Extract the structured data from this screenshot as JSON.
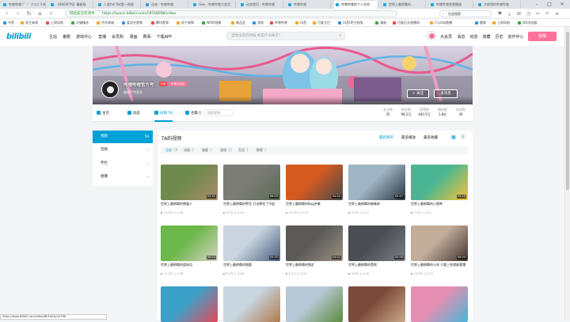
{
  "browser": {
    "tabs": [
      {
        "label": "哔哩哔哩 (゜-゜)つロ 干杯",
        "active": false
      },
      {
        "label": "【4K60FPS】最新版",
        "active": false
      },
      {
        "label": "人类fall flat第一视角",
        "active": false
      },
      {
        "label": "动态 - 哔哩哔哩",
        "active": false
      },
      {
        "label": "Gee - 哔哩哔哩大会员",
        "active": false
      },
      {
        "label": "动态首页 - 哔哩哔哩",
        "active": false
      },
      {
        "label": "哔哩哔哩",
        "active": false
      },
      {
        "label": "哔哩哔哩的个人空间",
        "active": true
      },
      {
        "label": "世界上最倒霉的...",
        "active": false
      },
      {
        "label": "哔哩哔哩视频播放",
        "active": false
      },
      {
        "label": "大侠哥的哔哩哔哩",
        "active": false
      }
    ],
    "secure_label": "网站安全检测中",
    "url": "https://space.bilibili.com/19558098/video",
    "search_value": "在此搜索",
    "bookmarks": [
      "书签",
      "发生来源",
      "上网导航",
      "天猫精选",
      "京东商城",
      "爱奇艺视频",
      "腾讯视频",
      "苏宁易购",
      "NOW直播",
      "唯品会",
      "游戏",
      "哔哩哔哩",
      "抖音",
      "可爱大巴",
      "抖音UP主权限",
      "漫画",
      "可爱石头直播间",
      "Crystal直播",
      "酷狗",
      "上网导航",
      "QQ浏览器"
    ],
    "status_url": "https://www.bilibili.com/video/BV1bG4y1E7B6"
  },
  "site_header": {
    "logo": "bilibili",
    "nav": [
      "主站",
      "番剧",
      "游戏中心",
      "直播",
      "会员购",
      "漫画",
      "赛事",
      "下载APP"
    ],
    "search_placeholder": "当你没有的时候 你是什么样子？",
    "right_nav": [
      "大会员",
      "消息",
      "动态",
      "收藏",
      "历史",
      "创作中心"
    ],
    "upload_label": "投稿"
  },
  "profile": {
    "name": "哔哩哔哩官方号",
    "level": "LV6",
    "vip": "年度大会员",
    "sign": "编辑个性签名",
    "follow_label": "+ 关注",
    "message_label": "发消息",
    "tabs": [
      {
        "label": "主页",
        "active": false
      },
      {
        "label": "动态",
        "active": false
      },
      {
        "label": "投稿 59",
        "active": true
      },
      {
        "label": "合集 1",
        "active": false
      }
    ],
    "search_placeholder": "搜索视频",
    "stats": [
      {
        "label": "关注数",
        "value": "35"
      },
      {
        "label": "粉丝数",
        "value": "98.2万"
      },
      {
        "label": "获赞数",
        "value": "400.5万"
      },
      {
        "label": "播放数",
        "value": "1.8亿"
      },
      {
        "label": "阅读数",
        "value": "39"
      }
    ]
  },
  "left_menu": [
    {
      "label": "视频",
      "count": "59",
      "active": true
    },
    {
      "label": "音频",
      "count": "",
      "active": false
    },
    {
      "label": "专栏",
      "count": "",
      "active": false
    },
    {
      "label": "相簿",
      "count": "",
      "active": false
    }
  ],
  "main": {
    "title": "TA的视频",
    "sorts": [
      {
        "label": "最新发布",
        "active": true
      },
      {
        "label": "最多播放",
        "active": false
      },
      {
        "label": "最多收藏",
        "active": false
      }
    ],
    "filters": [
      {
        "label": "全部",
        "count": "59",
        "active": true
      },
      {
        "label": "动画",
        "count": "3",
        "active": false
      },
      {
        "label": "鬼畜",
        "count": "1",
        "active": false
      },
      {
        "label": "游戏",
        "count": "53",
        "active": false
      },
      {
        "label": "生活",
        "count": "1",
        "active": false
      },
      {
        "label": "影视",
        "count": "1",
        "active": false
      }
    ],
    "videos": [
      {
        "title": "世界上最倒霉的熊猫人",
        "duration": "05:21",
        "plays": "10.2万",
        "date": "4-18",
        "c1": "#6f8a4e",
        "c2": "#a98c6a"
      },
      {
        "title": "世界上最倒霉的警官 打击罪犯了不起",
        "duration": "06:03",
        "plays": "8.7万",
        "date": "4-16",
        "c1": "#7d7d78",
        "c2": "#5a6b53"
      },
      {
        "title": "世界上最倒霉的Bug合集",
        "duration": "04:52",
        "plays": "12.5万",
        "date": "4-14",
        "c1": "#d45a1f",
        "c2": "#4a4a4a"
      },
      {
        "title": "世界上最倒霉的蜘蛛侠",
        "duration": "05:47",
        "plays": "9.3万",
        "date": "4-12",
        "c1": "#9fb5c4",
        "c2": "#2b3540"
      },
      {
        "title": "世界上最倒霉的小黄鸭",
        "duration": "05:10",
        "plays": "7.9万",
        "date": "4-10",
        "c1": "#4ab592",
        "c2": "#f2c23a"
      },
      {
        "title": "世界上最倒霉的篮球员",
        "duration": "06:15",
        "plays": "11.4万",
        "date": "4-08",
        "c1": "#6cb84a",
        "c2": "#d7d2c4"
      },
      {
        "title": "世界上最倒霉的跑酷",
        "duration": "05:33",
        "plays": "6.2万",
        "date": "4-06",
        "c1": "#c9d4de",
        "c2": "#465f7c"
      },
      {
        "title": "世界上最倒霉的铁匠",
        "duration": "04:41",
        "plays": "8.1万",
        "date": "4-04",
        "c1": "#5b5a58",
        "c2": "#9b9181"
      },
      {
        "title": "世界上最倒霉的黑帮",
        "duration": "05:58",
        "plays": "9.6万",
        "date": "4-02",
        "c1": "#4a4d52",
        "c2": "#7b7f84"
      },
      {
        "title": "世界上最倒霉的小孩 只要三秒就能看懂",
        "duration": "06:09",
        "plays": "13.8万",
        "date": "3-31",
        "c1": "#c2ad9a",
        "c2": "#3f3230"
      },
      {
        "title": "",
        "duration": "",
        "plays": "",
        "date": "",
        "c1": "#3ba0c8",
        "c2": "#e24a5a"
      },
      {
        "title": "",
        "duration": "",
        "plays": "",
        "date": "",
        "c1": "#c8d6e0",
        "c2": "#b07a4c"
      },
      {
        "title": "",
        "duration": "",
        "plays": "",
        "date": "",
        "c1": "#b7c8d6",
        "c2": "#5b8b3c"
      },
      {
        "title": "",
        "duration": "",
        "plays": "",
        "date": "",
        "c1": "#7c4a3a",
        "c2": "#c9a986"
      },
      {
        "title": "",
        "duration": "",
        "plays": "",
        "date": "",
        "c1": "#e58fb2",
        "c2": "#4ab5d8"
      }
    ]
  },
  "colors": {
    "bili_blue": "#00a1d6",
    "bili_pink": "#fb7299"
  }
}
